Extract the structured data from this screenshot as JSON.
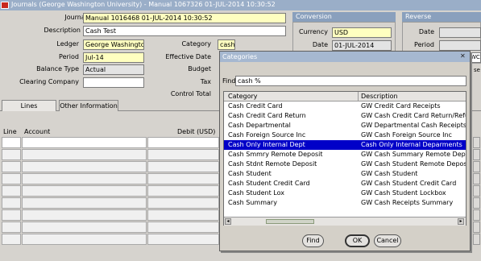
{
  "window": {
    "title": "Journals (George Washington University) - Manual 1067326 01-JUL-2014 10:30:52"
  },
  "header": {
    "journal_label": "Journal",
    "journal_value": "Manual 1016468 01-JUL-2014 10:30:52",
    "description_label": "Description",
    "description_value": "Cash Test",
    "ledger_label": "Ledger",
    "ledger_value": "George Washington",
    "period_label": "Period",
    "period_value": "Jul-14",
    "balance_type_label": "Balance Type",
    "balance_type_value": "Actual",
    "clearing_company_label": "Clearing Company",
    "clearing_company_value": "",
    "category_label": "Category",
    "category_value": "cash",
    "effective_date_label": "Effective Date",
    "budget_label": "Budget",
    "tax_label": "Tax",
    "control_total_label": "Control Total"
  },
  "conversion": {
    "header": "Conversion",
    "currency_label": "Currency",
    "currency_value": "USD",
    "date_label": "Date",
    "date_value": "01-JUL-2014"
  },
  "reverse": {
    "header": "Reverse",
    "date_label": "Date",
    "period_label": "Period",
    "partial_1": "WC",
    "partial_2": "se"
  },
  "tabs": [
    "Lines",
    "Other Information"
  ],
  "lines": {
    "line_header": "Line",
    "account_header": "Account",
    "debit_header": "Debit (USD)"
  },
  "dialog": {
    "title": "Categories",
    "find_label": "Find",
    "find_value": "cash %",
    "col_category": "Category",
    "col_description": "Description",
    "rows": [
      {
        "category": "Cash Credit Card",
        "description": "GW Credit Card Receipts"
      },
      {
        "category": "Cash Credit Card Return",
        "description": "GW Cash Credit Card Return/Refund"
      },
      {
        "category": "Cash Departmental",
        "description": "GW Departmental Cash Receipts"
      },
      {
        "category": "Cash Foreign Source Inc",
        "description": "GW Cash Foreign Source Inc"
      },
      {
        "category": "Cash Only Internal Dept",
        "description": "Cash Only Internal Deparments"
      },
      {
        "category": "Cash Smmry Remote Deposit",
        "description": "GW Cash Summary Remote Deposit"
      },
      {
        "category": "Cash Stdnt Remote Deposit",
        "description": "GW Cash Student Remote Deposit"
      },
      {
        "category": "Cash Student",
        "description": "GW Cash Student"
      },
      {
        "category": "Cash Student Credit Card",
        "description": "GW Cash Student Credit Card"
      },
      {
        "category": "Cash Student Lox",
        "description": "GW Cash Student Lockbox"
      },
      {
        "category": "Cash Summary",
        "description": "GW Cash Receipts Summary"
      }
    ],
    "selected_index": 4,
    "find_button": "Find",
    "ok_button": "OK",
    "cancel_button": "Cancel",
    "close_glyph": "✕"
  },
  "colors": {
    "title_bar": "#9aaec8",
    "group_header": "#8aa0bd",
    "required_field": "#ffffc0",
    "selection": "#0000c8"
  }
}
